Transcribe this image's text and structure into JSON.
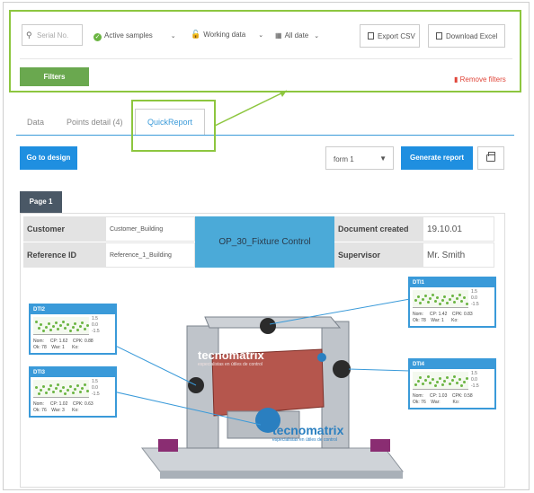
{
  "filters": {
    "serial_placeholder": "Serial No.",
    "active_samples": "Active samples",
    "working_data": "Working data",
    "all_date": "All date",
    "export_csv": "Export CSV",
    "download_excel": "Download Excel",
    "filters_button": "Filters",
    "remove_filters": "Remove filters"
  },
  "tabs": [
    {
      "label": "Data"
    },
    {
      "label": "Points detail (4)"
    },
    {
      "label": "QuickReport",
      "active": true
    }
  ],
  "actions": {
    "go_to_design": "Go to design",
    "form_select_value": "form 1",
    "generate_report": "Generate report"
  },
  "page_tab": "Page 1",
  "report": {
    "customer_label": "Customer",
    "customer_value": "Customer_Building",
    "reference_label": "Reference ID",
    "reference_value": "Reference_1_Building",
    "op_title": "OP_30_Fixture Control",
    "doc_created_label": "Document created",
    "doc_created_value": "19.10.01",
    "supervisor_label": "Supervisor",
    "supervisor_value": "Mr. Smith"
  },
  "brand": {
    "logo_text": "tecnomatrix",
    "tagline": "especialistas en útiles de control"
  },
  "dti_cards": [
    {
      "name": "DTI2",
      "scale": "1.5\n0.0\n-1.5",
      "stats": "Nom:     CP: 1.62    CPK: 0.88\nOk: 78    War: 1      Ko:"
    },
    {
      "name": "DTI3",
      "scale": "1.5\n0.0\n-1.5",
      "stats": "Nom:     CP: 1.02    CPK: 0.63\nOk: 76    War: 3      Ko:"
    },
    {
      "name": "DTI1",
      "scale": "1.5\n0.0\n-1.5",
      "stats": "Nom:     CP: 1.42    CPK: 0.83\nOk: 78    War: 1      Ko:"
    },
    {
      "name": "DTI4",
      "scale": "1.5\n0.0\n-1.5",
      "stats": "Nom:     CP: 1.03    CPK: 0.58\nOk: 76    War:          Ko:"
    }
  ],
  "colors": {
    "accent_green": "#8dc63f",
    "primary_blue": "#1f8fe0",
    "danger_red": "#e0463a",
    "header_cell": "#4baad8"
  }
}
